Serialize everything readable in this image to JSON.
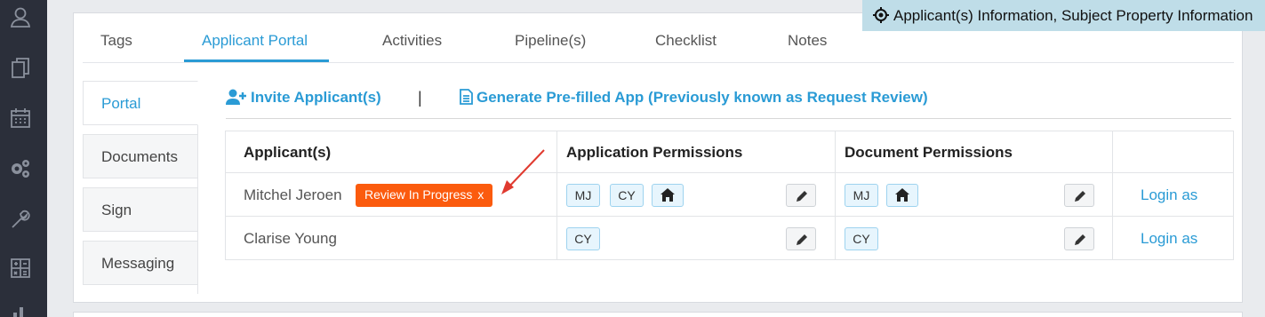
{
  "tooltip": {
    "icon": "crosshair-icon",
    "text": "Applicant(s) Information, Subject Property Information"
  },
  "sidebar": {
    "icons": [
      "user-icon",
      "documents-icon",
      "calendar-icon",
      "settings-icon",
      "wrench-icon",
      "calculator-icon",
      "chart-icon"
    ]
  },
  "tabs": [
    "Tags",
    "Applicant Portal",
    "Activities",
    "Pipeline(s)",
    "Checklist",
    "Notes"
  ],
  "active_tab": "Applicant Portal",
  "side_tabs": [
    "Portal",
    "Documents",
    "Sign",
    "Messaging"
  ],
  "active_side_tab": "Portal",
  "actions": {
    "invite": "Invite Applicant(s)",
    "separator": "|",
    "generate": "Generate Pre-filled App (Previously known as Request Review)"
  },
  "table": {
    "headers": [
      "Applicant(s)",
      "Application Permissions",
      "Document Permissions",
      ""
    ],
    "rows": [
      {
        "name": "Mitchel Jeroen",
        "status": "Review In Progress",
        "status_close": "x",
        "app_perms": [
          "MJ",
          "CY",
          "home-icon"
        ],
        "doc_perms": [
          "MJ",
          "home-icon"
        ],
        "login": "Login as"
      },
      {
        "name": "Clarise Young",
        "status": "",
        "app_perms": [
          "CY"
        ],
        "doc_perms": [
          "CY"
        ],
        "login": "Login as"
      }
    ]
  },
  "colors": {
    "accent": "#2a9bd5",
    "badge": "#fb5b0e",
    "sidebar": "#2b2f3a",
    "tooltip": "#bfdde8"
  }
}
